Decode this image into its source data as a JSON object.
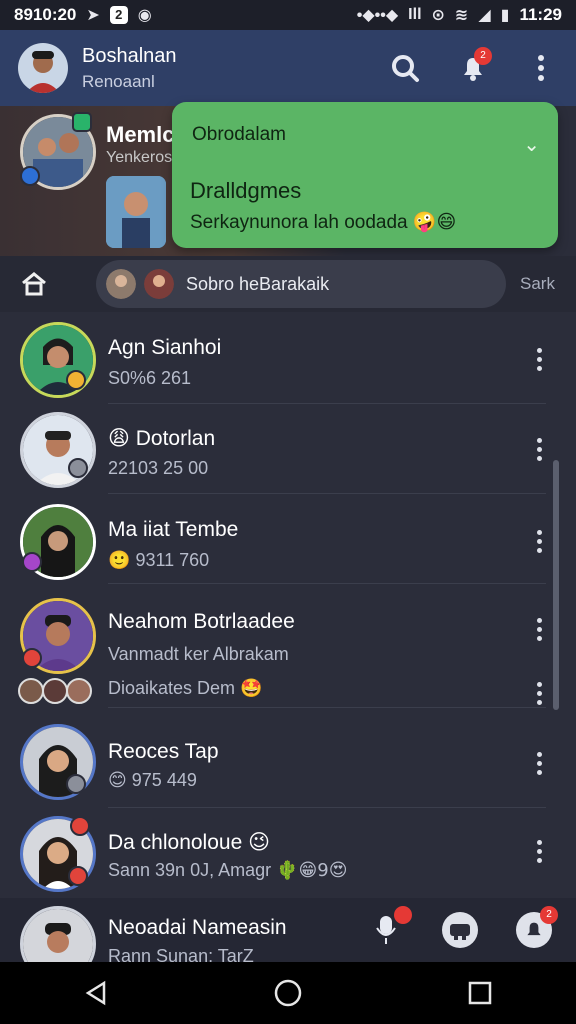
{
  "status_bar": {
    "time_left": "8910:20",
    "time_right": "11:29",
    "badge_label": "2"
  },
  "header": {
    "title": "Boshalnan",
    "subtitle": "Renoaanl",
    "notification_count": "2"
  },
  "story": {
    "name": "Memlc",
    "subtitle": "Yenkeros"
  },
  "popup": {
    "title": "Obrodalam",
    "heading": "Dralldgmes",
    "text": "Serkaynunora lah oodada",
    "emojis": "🤪😄"
  },
  "search_row": {
    "text": "Sobro heBarakaik",
    "action_label": "Sark"
  },
  "chats": [
    {
      "name": "Agn Sianhoi",
      "meta": "S0%6 261",
      "emoji_prefix": ""
    },
    {
      "name": "Dotorlan",
      "meta": "22103 25 00",
      "emoji_prefix": "😩"
    },
    {
      "name": "Ma iiat Tembe",
      "meta": "9311 760",
      "emoji_prefix": "🙂"
    },
    {
      "name": "Neahom Botrlaadee",
      "meta": "Vanmadt ker Albrakam",
      "extra": "Dioaikates Dem",
      "extra_emoji": "🤩"
    },
    {
      "name": "Reoces Tap",
      "meta": "975 449",
      "emoji_prefix": "😊"
    },
    {
      "name": "Da chlonoloue",
      "meta": "Sann 39n 0J, Amagr",
      "name_emoji": "😉",
      "trailing_emojis": "🌵😁9😍"
    },
    {
      "name": "Neoadai Nameasin",
      "meta": "Rann Sunan: TarZ"
    }
  ],
  "bottom_bar": {
    "badge_count": "2"
  },
  "colors": {
    "app_bar": "#2f3f66",
    "popup_green": "#5bb565",
    "background": "#2b2d3a"
  },
  "icons": [
    "search-icon",
    "bell-icon",
    "more-vert-icon",
    "home-icon",
    "back-icon",
    "home-circle-icon",
    "recents-icon",
    "mic-icon",
    "gamepad-icon",
    "bell-icon"
  ]
}
